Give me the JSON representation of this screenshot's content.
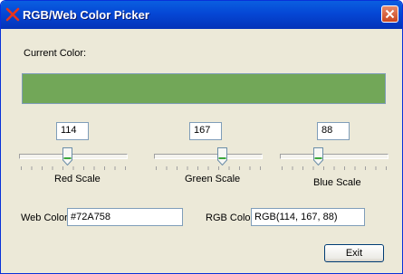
{
  "window": {
    "title": "RGB/Web Color Picker",
    "close_icon": "close-icon"
  },
  "current_color": {
    "label": "Current Color:",
    "color": "#72A758"
  },
  "red": {
    "value": "114",
    "label": "Red Scale",
    "level": 0.447
  },
  "green": {
    "value": "167",
    "label": "Green Scale",
    "level": 0.655
  },
  "blue": {
    "value": "88",
    "label": "Blue Scale",
    "level": 0.345
  },
  "web_color": {
    "label": "Web Color:",
    "value": "#72A758"
  },
  "rgb_color": {
    "label": "RGB Color:",
    "value": "RGB(114, 167, 88)"
  },
  "buttons": {
    "exit": "Exit"
  },
  "colors": {
    "titlebar": "#0547d5",
    "window_bg": "#ece9d8",
    "border": "#7f9db9"
  }
}
